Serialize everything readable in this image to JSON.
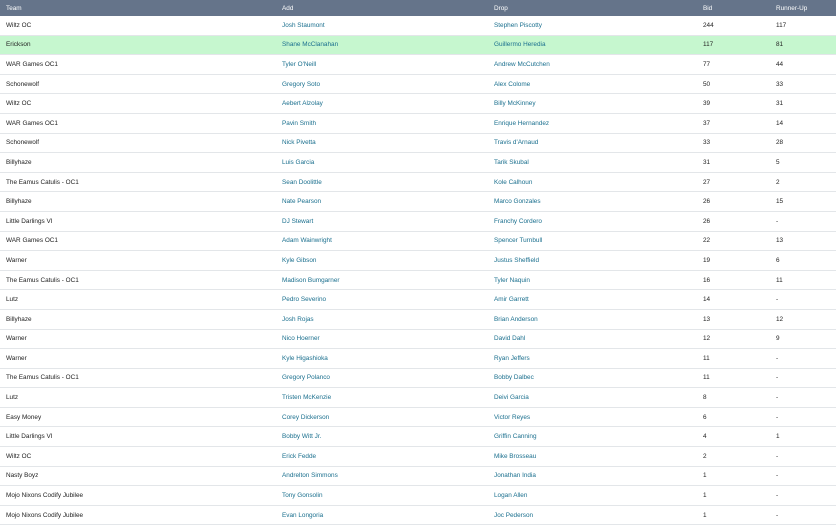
{
  "headers": {
    "team": "Team",
    "add": "Add",
    "drop": "Drop",
    "bid": "Bid",
    "runner_up": "Runner-Up"
  },
  "colors": {
    "header_bg": "#65748a",
    "highlight_row_bg": "#c6f7cf",
    "link": "#1a6f8e"
  },
  "rows": [
    {
      "team": "Wiltz OC",
      "add": "Josh Staumont",
      "drop": "Stephen Piscotty",
      "bid": "244",
      "runner_up": "117"
    },
    {
      "team": "Erickson",
      "add": "Shane McClanahan",
      "drop": "Guillermo Heredia",
      "bid": "117",
      "runner_up": "81",
      "highlighted": true
    },
    {
      "team": "WAR Games OC1",
      "add": "Tyler O'Neill",
      "drop": "Andrew McCutchen",
      "bid": "77",
      "runner_up": "44"
    },
    {
      "team": "Schonewolf",
      "add": "Gregory Soto",
      "drop": "Alex Colome",
      "bid": "50",
      "runner_up": "33"
    },
    {
      "team": "Wiltz OC",
      "add": "Aebert Alzolay",
      "drop": "Billy McKinney",
      "bid": "39",
      "runner_up": "31"
    },
    {
      "team": "WAR Games OC1",
      "add": "Pavin Smith",
      "drop": "Enrique Hernandez",
      "bid": "37",
      "runner_up": "14"
    },
    {
      "team": "Schonewolf",
      "add": "Nick Pivetta",
      "drop": "Travis d'Arnaud",
      "bid": "33",
      "runner_up": "28"
    },
    {
      "team": "Billyhaze",
      "add": "Luis Garcia",
      "drop": "Tarik Skubal",
      "bid": "31",
      "runner_up": "5"
    },
    {
      "team": "The Eamus Catulis - OC1",
      "add": "Sean Doolittle",
      "drop": "Kole Calhoun",
      "bid": "27",
      "runner_up": "2"
    },
    {
      "team": "Billyhaze",
      "add": "Nate Pearson",
      "drop": "Marco Gonzales",
      "bid": "26",
      "runner_up": "15"
    },
    {
      "team": "Little Darlings VI",
      "add": "DJ Stewart",
      "drop": "Franchy Cordero",
      "bid": "26",
      "runner_up": "-"
    },
    {
      "team": "WAR Games OC1",
      "add": "Adam Wainwright",
      "drop": "Spencer Turnbull",
      "bid": "22",
      "runner_up": "13"
    },
    {
      "team": "Warner",
      "add": "Kyle Gibson",
      "drop": "Justus Sheffield",
      "bid": "19",
      "runner_up": "6"
    },
    {
      "team": "The Eamus Catulis - OC1",
      "add": "Madison Bumgarner",
      "drop": "Tyler Naquin",
      "bid": "16",
      "runner_up": "11"
    },
    {
      "team": "Lutz",
      "add": "Pedro Severino",
      "drop": "Amir Garrett",
      "bid": "14",
      "runner_up": "-"
    },
    {
      "team": "Billyhaze",
      "add": "Josh Rojas",
      "drop": "Brian Anderson",
      "bid": "13",
      "runner_up": "12"
    },
    {
      "team": "Warner",
      "add": "Nico Hoerner",
      "drop": "David Dahl",
      "bid": "12",
      "runner_up": "9"
    },
    {
      "team": "Warner",
      "add": "Kyle Higashioka",
      "drop": "Ryan Jeffers",
      "bid": "11",
      "runner_up": "-"
    },
    {
      "team": "The Eamus Catulis - OC1",
      "add": "Gregory Polanco",
      "drop": "Bobby Dalbec",
      "bid": "11",
      "runner_up": "-"
    },
    {
      "team": "Lutz",
      "add": "Tristen McKenzie",
      "drop": "Deivi Garcia",
      "bid": "8",
      "runner_up": "-"
    },
    {
      "team": "Easy Money",
      "add": "Corey Dickerson",
      "drop": "Victor Reyes",
      "bid": "6",
      "runner_up": "-"
    },
    {
      "team": "Little Darlings VI",
      "add": "Bobby Witt Jr.",
      "drop": "Griffin Canning",
      "bid": "4",
      "runner_up": "1"
    },
    {
      "team": "Wiltz OC",
      "add": "Erick Fedde",
      "drop": "Mike Brosseau",
      "bid": "2",
      "runner_up": "-"
    },
    {
      "team": "Nasty Boyz",
      "add": "Andrelton Simmons",
      "drop": "Jonathan India",
      "bid": "1",
      "runner_up": "-"
    },
    {
      "team": "Mojo Nixons Codify Jubilee",
      "add": "Tony Gonsolin",
      "drop": "Logan Allen",
      "bid": "1",
      "runner_up": "-"
    },
    {
      "team": "Mojo Nixons Codify Jubilee",
      "add": "Evan Longoria",
      "drop": "Joc Pederson",
      "bid": "1",
      "runner_up": "-"
    }
  ]
}
